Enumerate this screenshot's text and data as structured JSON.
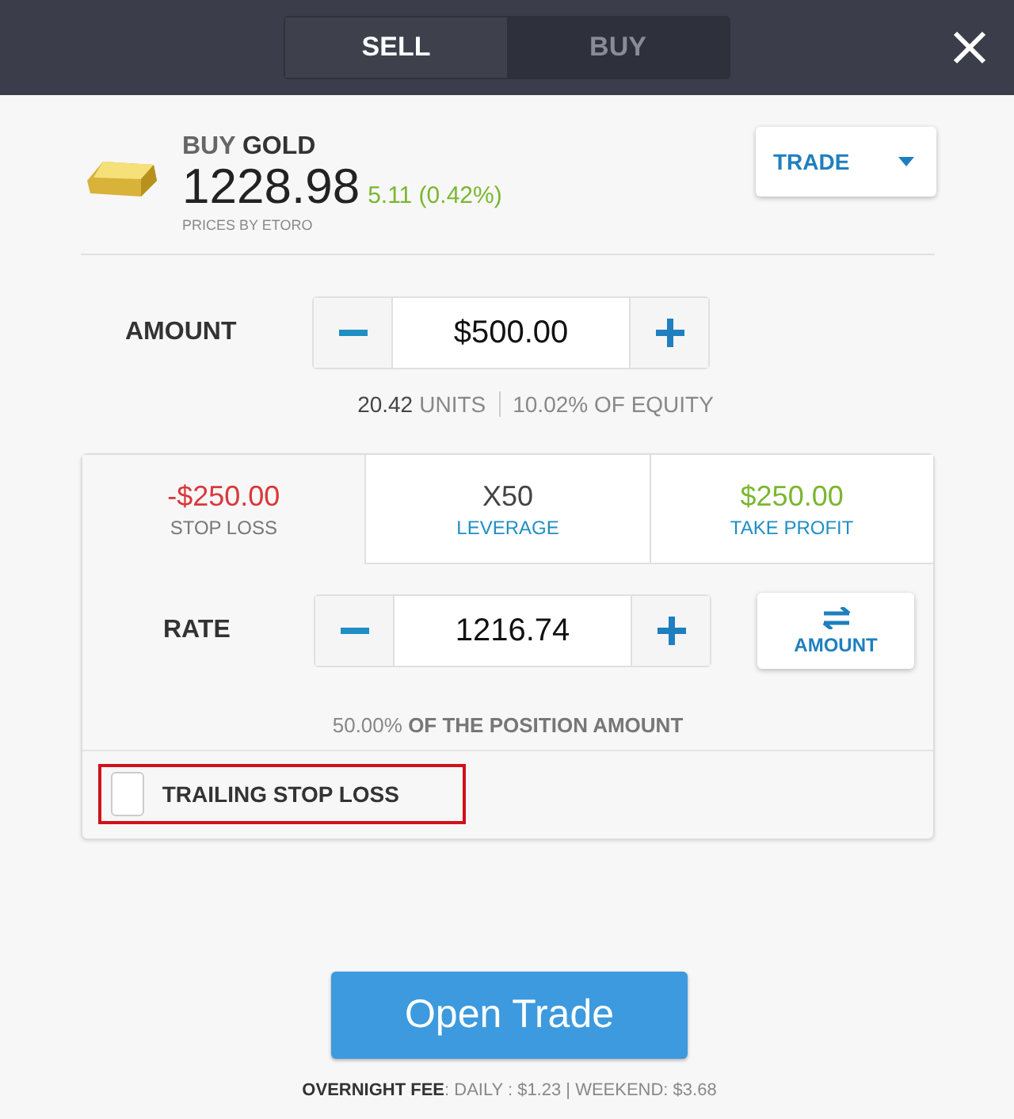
{
  "header": {
    "tabs": [
      {
        "label": "SELL",
        "selected": true
      },
      {
        "label": "BUY",
        "selected": false
      }
    ]
  },
  "instrument": {
    "action": "BUY",
    "name": "GOLD",
    "price": "1228.98",
    "change": "5.11 (0.42%)",
    "source": "PRICES BY ETORO"
  },
  "mode_dropdown": {
    "label": "TRADE"
  },
  "amount": {
    "label": "AMOUNT",
    "value": "$500.00",
    "units_value": "20.42",
    "units_label": "UNITS",
    "equity": "10.02% OF EQUITY"
  },
  "order_tabs": [
    {
      "value": "-$250.00",
      "label": "STOP LOSS",
      "selected": true,
      "kind": "loss"
    },
    {
      "value": "X50",
      "label": "LEVERAGE",
      "selected": false,
      "kind": "neutral"
    },
    {
      "value": "$250.00",
      "label": "TAKE PROFIT",
      "selected": false,
      "kind": "profit"
    }
  ],
  "rate": {
    "label": "RATE",
    "value": "1216.74",
    "toggle": "AMOUNT",
    "note": "50.00% **OF THE POSITION AMOUNT**"
  },
  "trailing_stop": {
    "label": "TRAILING STOP LOSS",
    "checked": false,
    "highlighted": true
  },
  "open_button": "Open Trade",
  "fee": "**OVERNIGHT FEE**: DAILY : $1.23 | WEEKEND: $3.68"
}
